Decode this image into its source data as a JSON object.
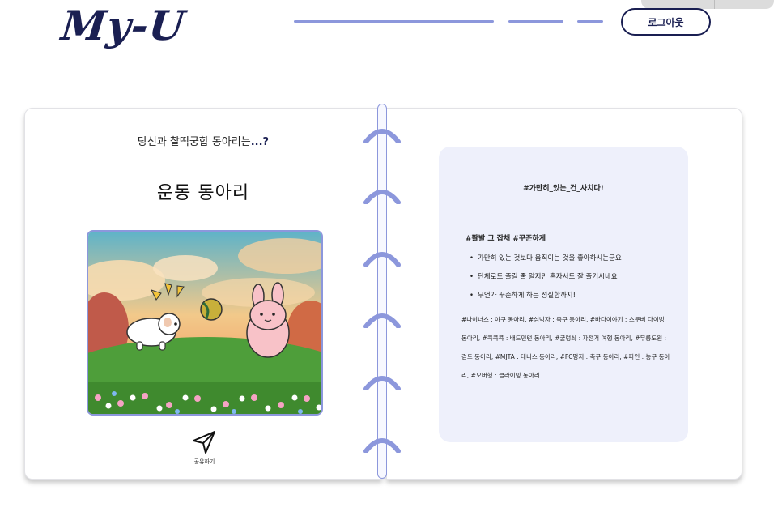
{
  "header": {
    "logo_text": "My-U",
    "logout_label": "로그아웃"
  },
  "result": {
    "question_prefix": "당신과 찰떡궁합 동아리는",
    "question_suffix": "...?",
    "club_type": "운동 동아리",
    "illustration": "cartoon-field-dog-bunny-ball",
    "share_icon": "paper-plane-icon",
    "share_label": "공유하기"
  },
  "detail": {
    "tagline": "#가만히_있는_건_사치다!",
    "heading": "#활발 그 잡채 #꾸준하게",
    "traits": [
      "가만히 있는 것보다 움직이는 것을 좋아하시는군요",
      "단체로도 즐길 줄 알지만 혼자서도 잘 즐기시네요",
      "무언가 꾸준하게 하는 성실함까지!"
    ],
    "clubs": "#나이너스 : 야구 동아리, #섬박자 : 족구 동아리, #바다이야기 : 스쿠버 다이빙 동아리, #콕콕콕 : 배드민턴 동아리, #굴렁쇠 : 자전거 여행 동아리, #무릉도원 : 검도 동아리, #MJTA : 테니스 동아리, #FC명지 : 축구 동아리, #파인 : 농구 동아리, #오버헹 : 클라이밍 동아리"
  },
  "colors": {
    "accent": "#8c97dc",
    "navy": "#1a1f52",
    "card_bg": "#eef0fb"
  }
}
